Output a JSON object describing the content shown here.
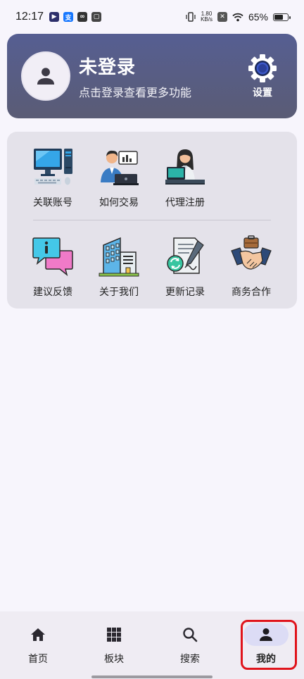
{
  "status_bar": {
    "time": "12:17",
    "net_speed_value": "1.80",
    "net_speed_unit": "KB/s",
    "battery_percent": "65%",
    "battery_level": 0.65
  },
  "profile": {
    "title": "未登录",
    "subtitle": "点击登录查看更多功能",
    "settings_label": "设置"
  },
  "grid": {
    "row1": [
      {
        "label": "关联账号",
        "icon": "computer-icon"
      },
      {
        "label": "如何交易",
        "icon": "trader-icon"
      },
      {
        "label": "代理注册",
        "icon": "agent-icon"
      }
    ],
    "row2": [
      {
        "label": "建议反馈",
        "icon": "feedback-icon"
      },
      {
        "label": "关于我们",
        "icon": "building-icon"
      },
      {
        "label": "更新记录",
        "icon": "update-record-icon"
      },
      {
        "label": "商务合作",
        "icon": "handshake-icon"
      }
    ]
  },
  "bottom_nav": {
    "items": [
      {
        "label": "首页",
        "icon": "home-icon"
      },
      {
        "label": "板块",
        "icon": "grid-icon"
      },
      {
        "label": "搜索",
        "icon": "search-icon"
      },
      {
        "label": "我的",
        "icon": "person-icon",
        "active": true
      }
    ]
  },
  "colors": {
    "header_gradient_top": "#565e92",
    "header_gradient_bottom": "#5a5c75",
    "highlight": "#e0141c",
    "active_nav_bg": "#dcdcf5"
  }
}
